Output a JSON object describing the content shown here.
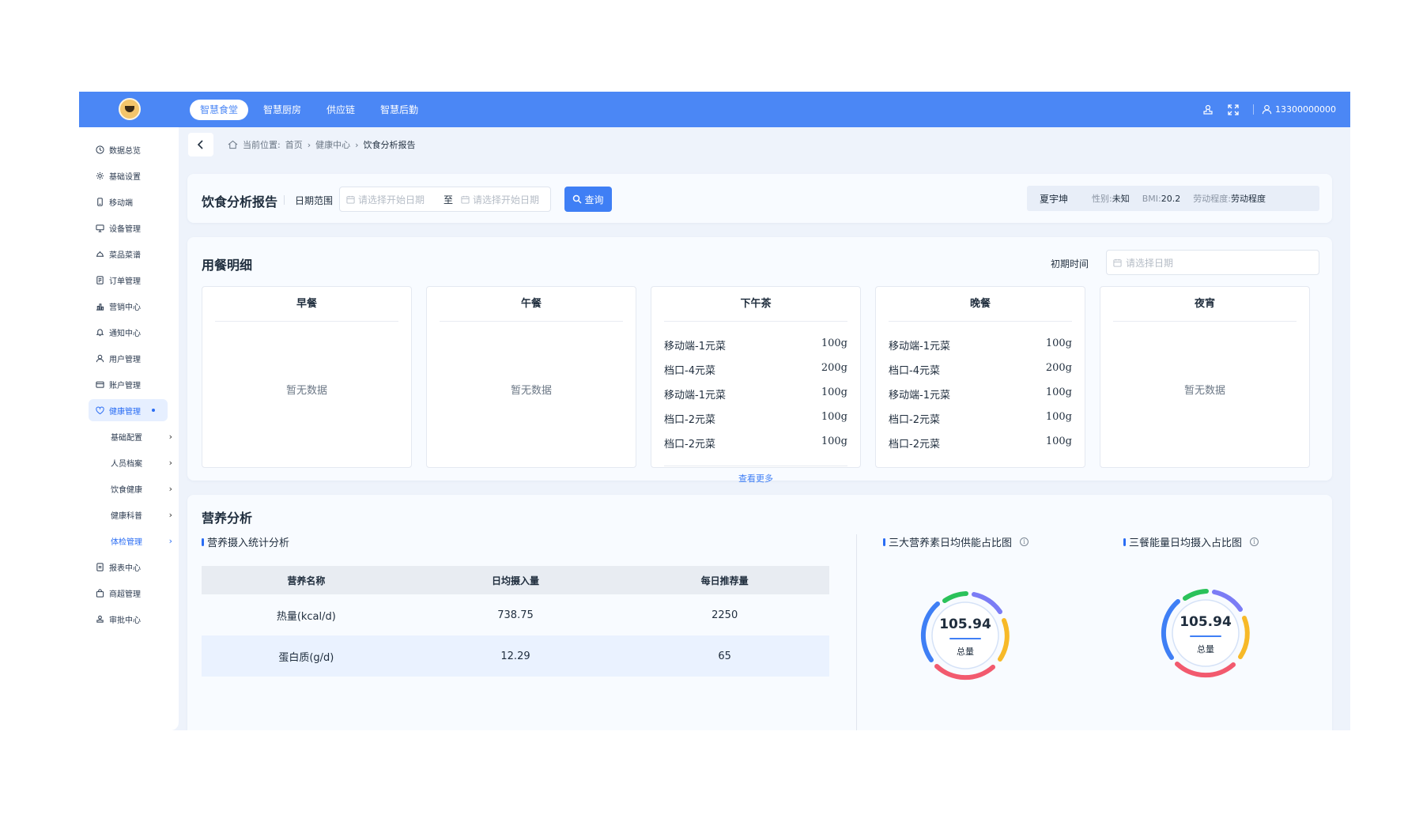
{
  "topbar": {
    "tabs": [
      "智慧食堂",
      "智慧厨房",
      "供应链",
      "智慧后勤"
    ],
    "active_tab": 0,
    "user": "13300000000"
  },
  "sidebar": {
    "items": [
      {
        "label": "数据总览",
        "icon": "clock-icon"
      },
      {
        "label": "基础设置",
        "icon": "gear-icon"
      },
      {
        "label": "移动端",
        "icon": "phone-icon"
      },
      {
        "label": "设备管理",
        "icon": "monitor-icon"
      },
      {
        "label": "菜品菜谱",
        "icon": "dish-icon"
      },
      {
        "label": "订单管理",
        "icon": "document-icon"
      },
      {
        "label": "营销中心",
        "icon": "chart-icon"
      },
      {
        "label": "通知中心",
        "icon": "bell-icon"
      },
      {
        "label": "用户管理",
        "icon": "user-icon"
      },
      {
        "label": "账户管理",
        "icon": "wallet-icon"
      },
      {
        "label": "健康管理",
        "icon": "heart-icon"
      }
    ],
    "sub_items": [
      "基础配置",
      "人员档案",
      "饮食健康",
      "健康科普",
      "体检管理"
    ],
    "bottom_items": [
      {
        "label": "报表中心",
        "icon": "report-icon"
      },
      {
        "label": "商超管理",
        "icon": "bag-icon"
      },
      {
        "label": "审批中心",
        "icon": "stamp-icon"
      }
    ]
  },
  "breadcrumb": {
    "prefix": "当前位置:",
    "items": [
      "首页",
      "健康中心"
    ],
    "current": "饮食分析报告"
  },
  "filter": {
    "title": "饮食分析报告",
    "range_label": "日期范围",
    "start_placeholder": "请选择开始日期",
    "to": "至",
    "end_placeholder": "请选择开始日期",
    "query": "查询"
  },
  "person": {
    "name": "夏宇坤",
    "gender_key": "性别:",
    "gender": "未知",
    "bmi_key": "BMI:",
    "bmi": "20.2",
    "labor_key": "劳动程度:",
    "labor": "劳动程度"
  },
  "meals": {
    "title": "用餐明细",
    "time_label": "初期时间",
    "date_placeholder": "请选择日期",
    "empty_text": "暂无数据",
    "more": "查看更多",
    "cards": [
      {
        "name": "早餐",
        "items": []
      },
      {
        "name": "午餐",
        "items": []
      },
      {
        "name": "下午茶",
        "items": [
          {
            "dish": "移动端-1元菜",
            "weight": "100g"
          },
          {
            "dish": "档口-4元菜",
            "weight": "200g"
          },
          {
            "dish": "移动端-1元菜",
            "weight": "100g"
          },
          {
            "dish": "档口-2元菜",
            "weight": "100g"
          },
          {
            "dish": "档口-2元菜",
            "weight": "100g"
          }
        ],
        "has_more": true
      },
      {
        "name": "晚餐",
        "items": [
          {
            "dish": "移动端-1元菜",
            "weight": "100g"
          },
          {
            "dish": "档口-4元菜",
            "weight": "200g"
          },
          {
            "dish": "移动端-1元菜",
            "weight": "100g"
          },
          {
            "dish": "档口-2元菜",
            "weight": "100g"
          },
          {
            "dish": "档口-2元菜",
            "weight": "100g"
          }
        ]
      },
      {
        "name": "夜宵",
        "items": []
      }
    ]
  },
  "nutrition": {
    "title": "营养分析",
    "table_title": "营养摄入统计分析",
    "columns": [
      "营养名称",
      "日均摄入量",
      "每日推荐量"
    ],
    "rows": [
      [
        "热量(kcal/d)",
        "738.75",
        "2250"
      ],
      [
        "蛋白质(g/d)",
        "12.29",
        "65"
      ]
    ],
    "donut1": {
      "title": "三大营养素日均供能占比图",
      "value": "105.94",
      "label": "总量"
    },
    "donut2": {
      "title": "三餐能量日均摄入占比图",
      "value": "105.94",
      "label": "总量"
    },
    "colors": {
      "green": "#2bc25a",
      "purple": "#7b7cf5",
      "yellow": "#f7b928",
      "red": "#f25a6e",
      "blue": "#3f7ff5"
    }
  }
}
